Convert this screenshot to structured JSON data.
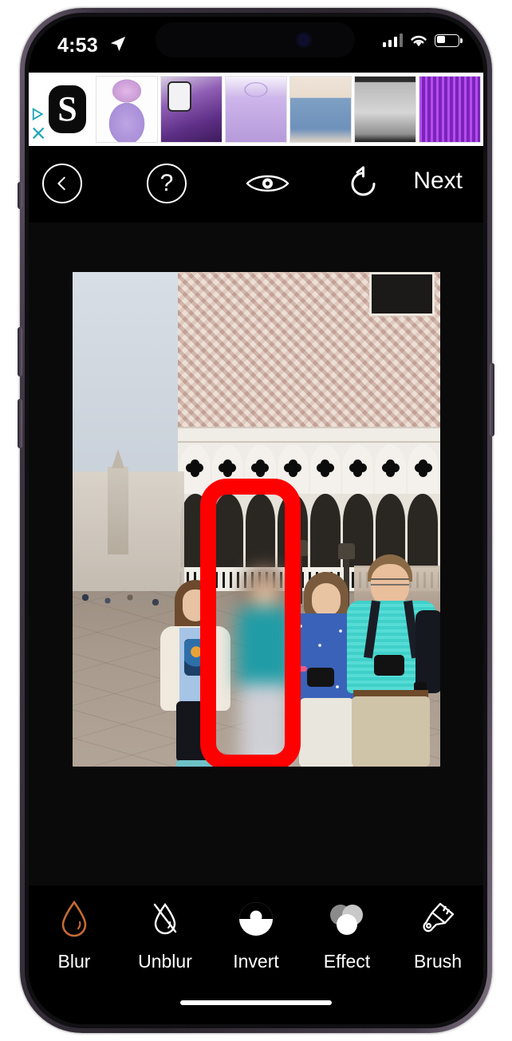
{
  "status_bar": {
    "time": "4:53",
    "location_icon": "location-arrow-icon",
    "cellular_icon": "signal-bars-icon",
    "wifi_icon": "wifi-icon",
    "battery_icon": "battery-icon"
  },
  "ad_banner": {
    "advertiser_logo_letter": "S",
    "adchoices_icon": "adchoices-icon",
    "close_icon": "close-ad-icon",
    "products": [
      {
        "name": "purple-tulle-dress"
      },
      {
        "name": "purple-phone-case"
      },
      {
        "name": "purple-backpack"
      },
      {
        "name": "denim-jumpsuit"
      },
      {
        "name": "grey-bomber-jacket"
      },
      {
        "name": "purple-curtain-lights"
      }
    ]
  },
  "editor_toolbar": {
    "back_icon": "chevron-left-icon",
    "help_label": "?",
    "preview_icon": "eye-icon",
    "undo_icon": "undo-arrow-icon",
    "next_label": "Next"
  },
  "canvas": {
    "photo_description": "Family photo in front of the Doge's Palace in Venice",
    "selection": {
      "shape": "rounded-rectangle",
      "color": "#fe0000",
      "stroke_width": 20
    }
  },
  "bottom_toolbar": {
    "active_tool": "Blur",
    "active_color": "#c76a33",
    "tools": [
      {
        "label": "Blur",
        "icon": "droplet-icon"
      },
      {
        "label": "Unblur",
        "icon": "droplet-slash-icon"
      },
      {
        "label": "Invert",
        "icon": "invert-circle-icon"
      },
      {
        "label": "Effect",
        "icon": "overlapping-circles-icon"
      },
      {
        "label": "Brush",
        "icon": "paintbrush-icon"
      }
    ]
  },
  "home_indicator": "home-indicator"
}
